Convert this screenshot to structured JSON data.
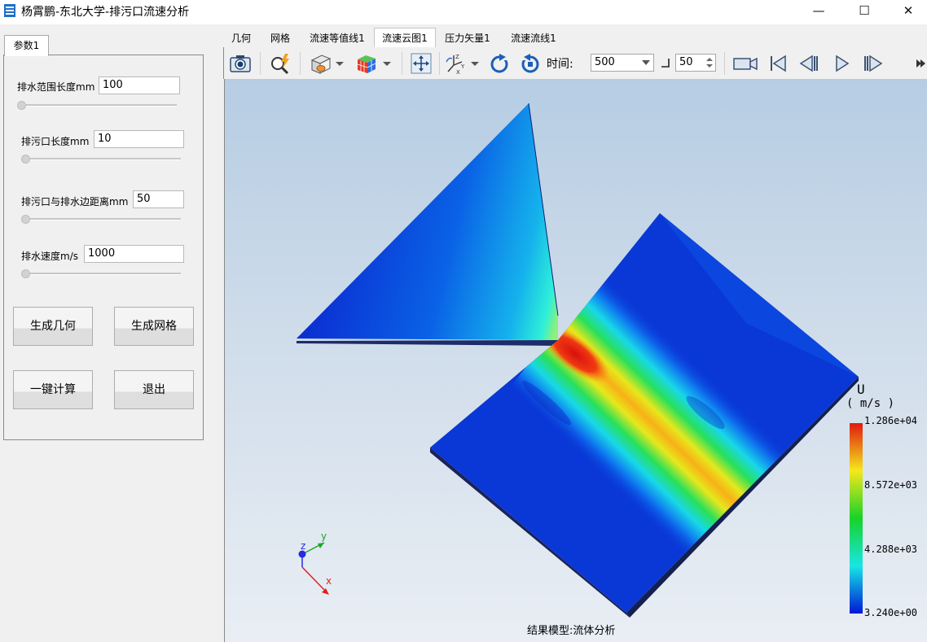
{
  "window": {
    "title": "杨霄鹏-东北大学-排污口流速分析",
    "minimize": "—",
    "maximize": "☐",
    "close": "✕"
  },
  "left_tab": {
    "label": "参数1"
  },
  "params": [
    {
      "label": "排水范围长度mm",
      "value": "100"
    },
    {
      "label": "排污口长度mm",
      "value": "10"
    },
    {
      "label": "排污口与排水边距离mm",
      "value": "50"
    },
    {
      "label": "排水速度m/s",
      "value": "1000"
    }
  ],
  "buttons": {
    "gen_geometry": "生成几何",
    "gen_mesh": "生成网格",
    "compute": "一键计算",
    "exit": "退出"
  },
  "tabs": [
    {
      "label": "几何",
      "active": false
    },
    {
      "label": "网格",
      "active": false
    },
    {
      "label": "流速等值线1",
      "active": false
    },
    {
      "label": "流速云图1",
      "active": true
    },
    {
      "label": "压力矢量1",
      "active": false
    },
    {
      "label": "流速流线1",
      "active": false
    }
  ],
  "toolbar": {
    "time_label": "时间:",
    "time_value": "500",
    "step_value": "50",
    "icons": [
      "camera-icon",
      "zoom-lightning-icon",
      "surface-display-icon",
      "color-map-icon",
      "fit-view-icon",
      "axes-orientation-icon",
      "rotate-icon",
      "reset-view-icon",
      "record-video-icon",
      "first-frame-icon",
      "prev-frame-icon",
      "play-icon",
      "next-frame-icon"
    ]
  },
  "viewport": {
    "caption": "结果模型:流体分析",
    "axis_labels": {
      "z": "z",
      "y": "y",
      "x": "x"
    }
  },
  "legend": {
    "var": "U",
    "unit": "( m/s )",
    "labels": [
      "1.286e+04",
      "8.572e+03",
      "4.288e+03",
      "3.240e+00"
    ],
    "colors": [
      "#e01a10",
      "#f5e81c",
      "#18d228",
      "#18e6e6",
      "#0018d6"
    ]
  }
}
